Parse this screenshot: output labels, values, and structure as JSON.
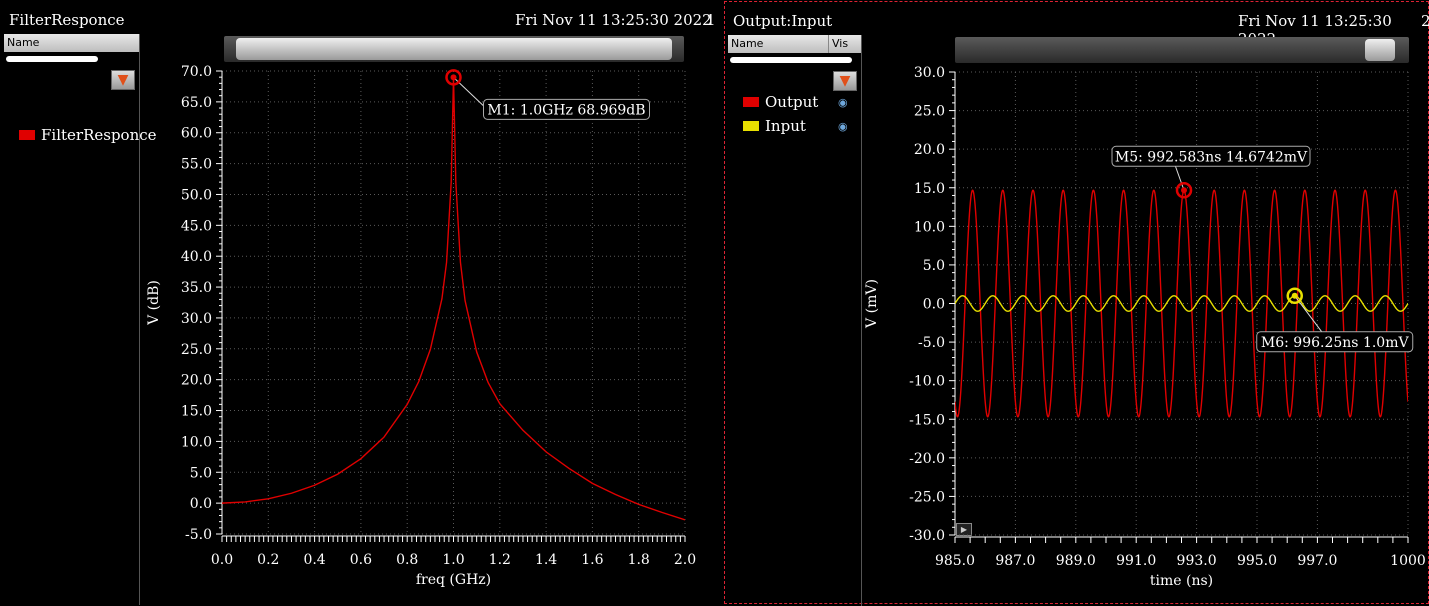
{
  "left_window": {
    "title": "FilterResponce",
    "date": "Fri Nov 11 13:25:30 2022",
    "subwindow_number": "1",
    "legend_header": "Name",
    "legend_items": [
      {
        "label": "FilterResponce",
        "color": "#e00000"
      }
    ]
  },
  "right_window": {
    "title": "Output:Input",
    "date": "Fri Nov 11 13:25:30 2022",
    "subwindow_number": "2",
    "legend_header": "Name",
    "legend_vis_header": "Vis",
    "legend_items": [
      {
        "label": "Output",
        "color": "#e00000"
      },
      {
        "label": "Input",
        "color": "#e8e000"
      }
    ]
  },
  "chart_data": [
    {
      "type": "line",
      "title": "FilterResponce",
      "xlabel": "freq (GHz)",
      "ylabel": "V (dB)",
      "xlim": [
        0.0,
        2.0
      ],
      "ylim": [
        -5.0,
        70.0
      ],
      "xticks": [
        "0.0",
        "0.2",
        "0.4",
        "0.6",
        "0.8",
        "1.0",
        "1.2",
        "1.4",
        "1.6",
        "1.8",
        "2.0"
      ],
      "yticks": [
        "-5.0",
        "0.0",
        "5.0",
        "10.0",
        "15.0",
        "20.0",
        "25.0",
        "30.0",
        "35.0",
        "40.0",
        "45.0",
        "50.0",
        "55.0",
        "60.0",
        "65.0",
        "70.0"
      ],
      "grid": true,
      "series": [
        {
          "name": "FilterResponce",
          "color": "#e00000",
          "x": [
            0.0,
            0.1,
            0.2,
            0.3,
            0.4,
            0.5,
            0.6,
            0.7,
            0.8,
            0.85,
            0.9,
            0.95,
            0.97,
            0.99,
            1.0,
            1.01,
            1.03,
            1.05,
            1.1,
            1.15,
            1.2,
            1.3,
            1.4,
            1.5,
            1.6,
            1.7,
            1.8,
            1.9,
            2.0
          ],
          "y": [
            0.0,
            0.2,
            0.7,
            1.6,
            2.9,
            4.7,
            7.2,
            10.7,
            16.0,
            19.7,
            24.9,
            33.1,
            39.0,
            52.0,
            68.969,
            52.0,
            39.0,
            32.8,
            24.5,
            19.5,
            16.1,
            11.8,
            8.3,
            5.6,
            3.2,
            1.4,
            -0.2,
            -1.5,
            -2.7
          ]
        }
      ],
      "markers": [
        {
          "label": "M1: 1.0GHz 68.969dB",
          "x": 1.0,
          "y": 68.969,
          "color": "#e00000"
        }
      ]
    },
    {
      "type": "line",
      "title": "Output:Input",
      "xlabel": "time (ns)",
      "ylabel": "V (mV)",
      "xlim": [
        985.0,
        1000.0
      ],
      "ylim": [
        -30.0,
        30.0
      ],
      "xticks": [
        "985.0",
        "987.0",
        "989.0",
        "991.0",
        "993.0",
        "995.0",
        "997.0",
        "1000"
      ],
      "yticks": [
        "-30.0",
        "-25.0",
        "-20.0",
        "-15.0",
        "-10.0",
        "-5.0",
        "0.0",
        "5.0",
        "10.0",
        "15.0",
        "20.0",
        "25.0",
        "30.0"
      ],
      "grid": true,
      "series": [
        {
          "name": "Output",
          "color": "#e00000",
          "waveform": "sine",
          "amplitude": 14.6742,
          "frequency_ghz": 1.0,
          "peak_time_ns": 992.583
        },
        {
          "name": "Input",
          "color": "#e8e000",
          "waveform": "sine",
          "amplitude": 1.0,
          "frequency_ghz": 1.0,
          "peak_time_ns": 996.25
        }
      ],
      "markers": [
        {
          "label": "M5: 992.583ns 14.6742mV",
          "x": 992.583,
          "y": 14.6742,
          "color": "#e00000"
        },
        {
          "label": "M6: 996.25ns 1.0mV",
          "x": 996.25,
          "y": 1.0,
          "color": "#e8e000"
        }
      ]
    }
  ]
}
